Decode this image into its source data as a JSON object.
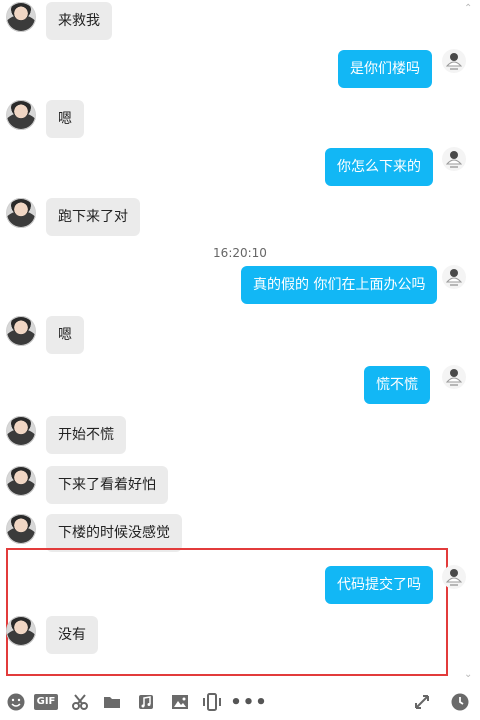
{
  "messages": [
    {
      "side": "left",
      "text": "来救我"
    },
    {
      "side": "right",
      "text": "是你们楼吗"
    },
    {
      "side": "left",
      "text": "嗯"
    },
    {
      "side": "right",
      "text": "你怎么下来的"
    },
    {
      "side": "left",
      "text": "跑下来了对"
    },
    {
      "side": "time",
      "text": "16:20:10"
    },
    {
      "side": "right",
      "text": "真的假的 你们在上面办公吗"
    },
    {
      "side": "left",
      "text": "嗯"
    },
    {
      "side": "right",
      "text": "慌不慌"
    },
    {
      "side": "left",
      "text": "开始不慌"
    },
    {
      "side": "left",
      "text": "下来了看着好怕"
    },
    {
      "side": "left",
      "text": "下楼的时候没感觉"
    },
    {
      "side": "right",
      "text": "代码提交了吗"
    },
    {
      "side": "left",
      "text": "没有"
    }
  ],
  "icons": {
    "emoji": "emoji-icon",
    "gif": "GIF",
    "scissors": "scissors-icon",
    "folder": "folder-icon",
    "music": "music-icon",
    "image": "image-icon",
    "shake": "shake-icon",
    "more": "more-icon",
    "expand": "expand-icon",
    "history": "history-icon"
  },
  "colors": {
    "bubble_right": "#12b7f5",
    "bubble_left": "#ebebeb",
    "highlight": "#e23b3b"
  }
}
